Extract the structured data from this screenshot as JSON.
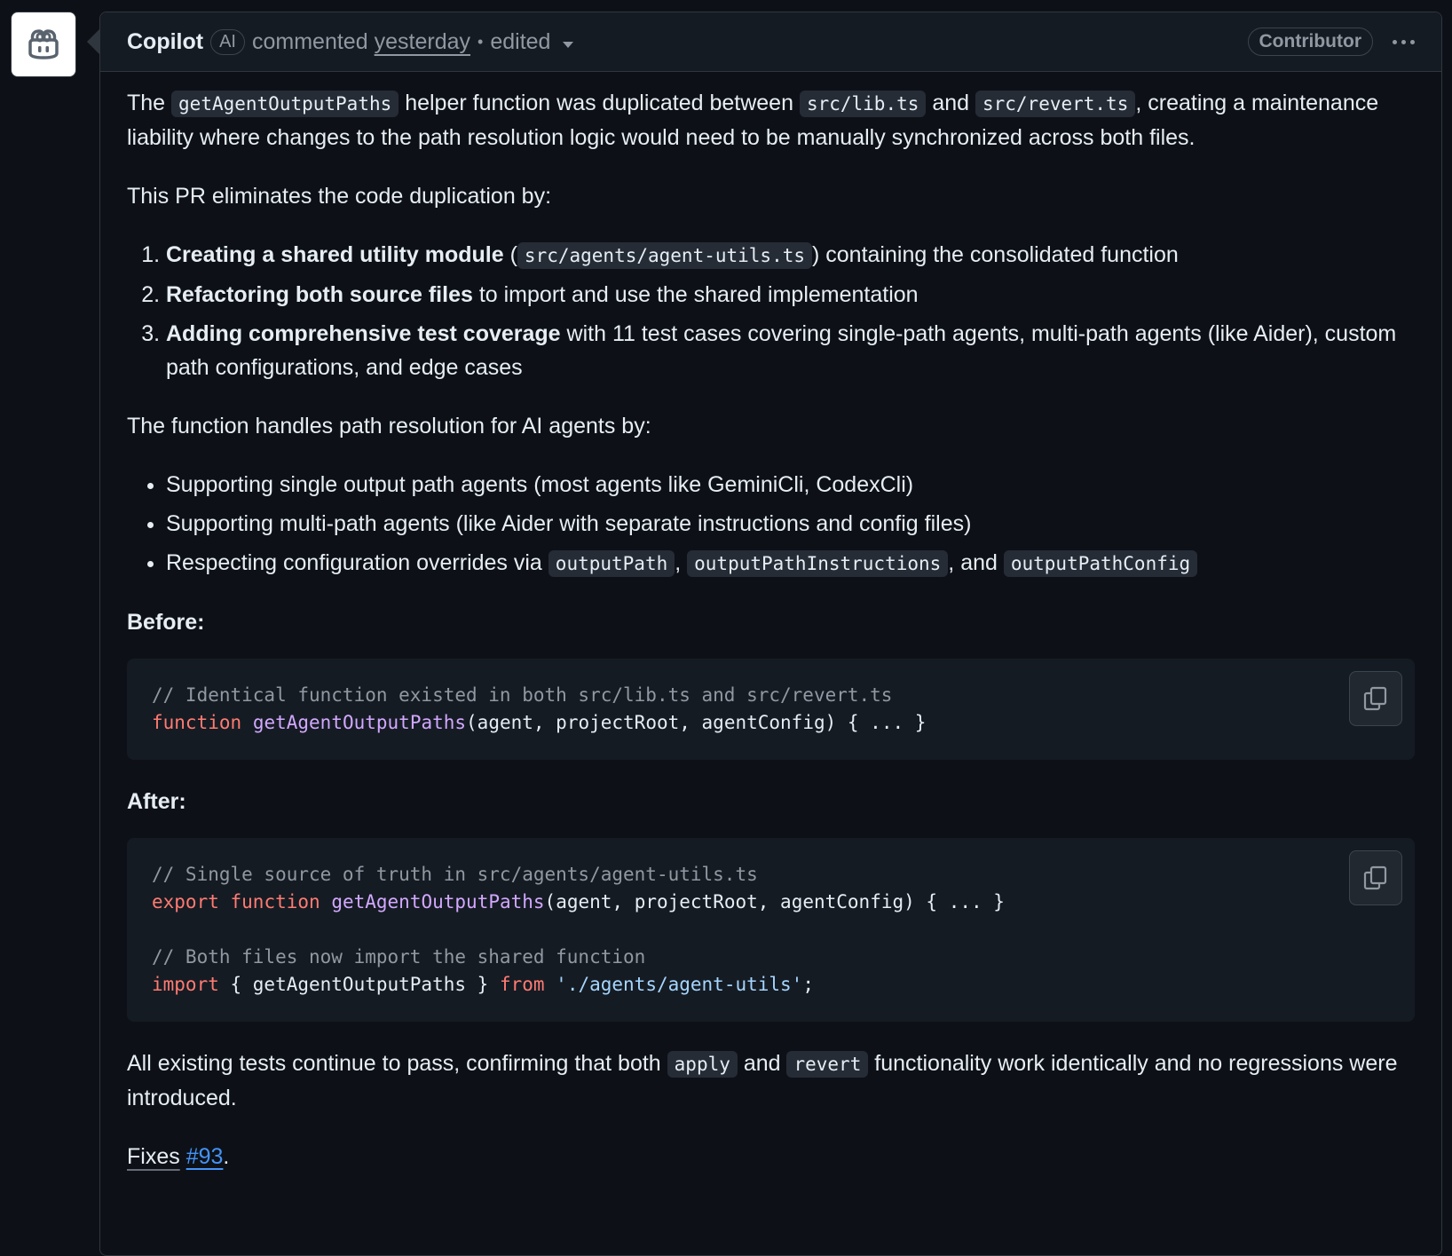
{
  "comment": {
    "author": "Copilot",
    "ai_badge": "AI",
    "action": "commented",
    "time": "yesterday",
    "separator": "•",
    "edited": "edited",
    "role": "Contributor"
  },
  "body": {
    "p1": {
      "t1": "The ",
      "c1": "getAgentOutputPaths",
      "t2": " helper function was duplicated between ",
      "c2": "src/lib.ts",
      "t3": " and ",
      "c3": "src/revert.ts",
      "t4": ", creating a maintenance liability where changes to the path resolution logic would need to be manually synchronized across both files."
    },
    "p2": "This PR eliminates the code duplication by:",
    "steps": [
      {
        "bold": "Creating a shared utility module",
        "pre": " (",
        "code": "src/agents/agent-utils.ts",
        "rest": ") containing the consolidated function"
      },
      {
        "bold": "Refactoring both source files",
        "rest": " to import and use the shared implementation"
      },
      {
        "bold": "Adding comprehensive test coverage",
        "rest": " with 11 test cases covering single-path agents, multi-path agents (like Aider), custom path configurations, and edge cases"
      }
    ],
    "p3": "The function handles path resolution for AI agents by:",
    "bullets": [
      "Supporting single output path agents (most agents like GeminiCli, CodexCli)",
      "Supporting multi-path agents (like Aider with separate instructions and config files)"
    ],
    "bullet3": {
      "t1": "Respecting configuration overrides via ",
      "c1": "outputPath",
      "t2": ", ",
      "c2": "outputPathInstructions",
      "t3": ", and ",
      "c3": "outputPathConfig"
    },
    "before_heading": "Before:",
    "before_code": {
      "comment": "// Identical function existed in both src/lib.ts and src/revert.ts",
      "kw": "function",
      "fn": "getAgentOutputPaths",
      "rest": "(agent, projectRoot, agentConfig) { ... }"
    },
    "after_heading": "After:",
    "after_code": {
      "comment1": "// Single source of truth in src/agents/agent-utils.ts",
      "kw1": "export",
      "kw2": "function",
      "fn": "getAgentOutputPaths",
      "rest": "(agent, projectRoot, agentConfig) { ... }",
      "comment2": "// Both files now import the shared function",
      "kw_import": "import",
      "import_mid": " { getAgentOutputPaths } ",
      "kw_from": "from",
      "str": "'./agents/agent-utils'",
      "end": ";"
    },
    "p4": {
      "t1": "All existing tests continue to pass, confirming that both ",
      "c1": "apply",
      "t2": " and ",
      "c2": "revert",
      "t3": " functionality work identically and no regressions were introduced."
    },
    "fixes": {
      "label": "Fixes",
      "issue": "#93",
      "end": "."
    }
  },
  "icons": {
    "avatar": "copilot-icon",
    "copy": "copy-icon",
    "menu": "kebab-horizontal-icon",
    "caret": "triangle-down-icon"
  },
  "colors": {
    "background": "#0d1117",
    "link": "#4493f8",
    "keyword": "#ff7b72",
    "function": "#d2a8ff",
    "string": "#a5d6ff"
  }
}
